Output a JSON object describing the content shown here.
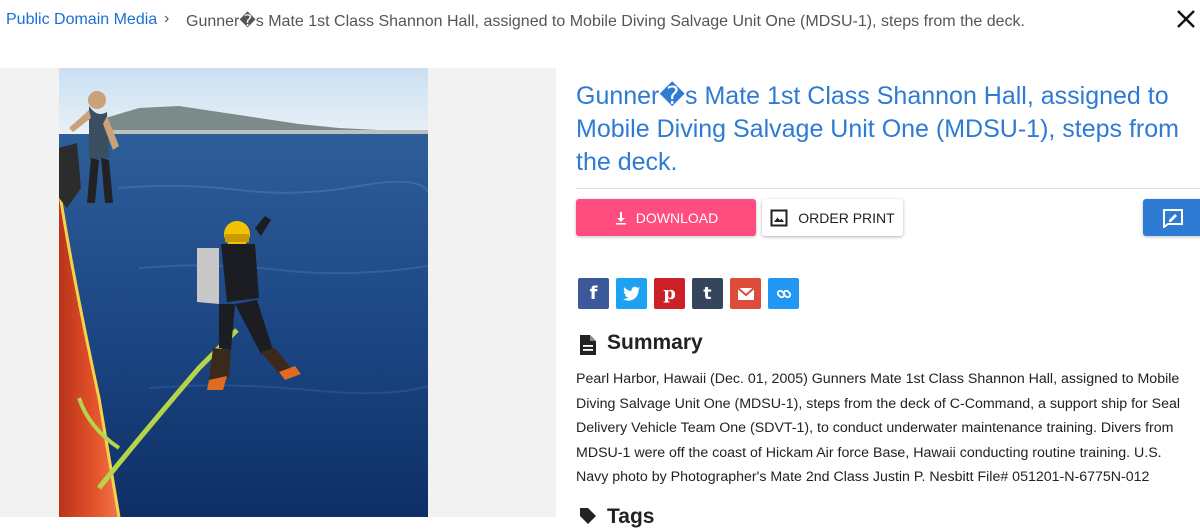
{
  "breadcrumb": {
    "root": "Public Domain Media",
    "separator": "›",
    "current": "Gunner�s Mate 1st Class Shannon Hall, assigned to Mobile Diving Salvage Unit One (MDSU-1), steps from the deck."
  },
  "title": "Gunner�s Mate 1st Class Shannon Hall, assigned to Mobile Diving Salvage Unit One (MDSU-1), steps from the deck.",
  "actions": {
    "download_label": "DOWNLOAD",
    "order_print_label": "ORDER PRINT"
  },
  "share_buttons": [
    {
      "name": "facebook",
      "glyph": "f",
      "color": "#3b5998"
    },
    {
      "name": "twitter",
      "glyph": "t",
      "color": "#1da1f2"
    },
    {
      "name": "pinterest",
      "glyph": "p",
      "color": "#cb2027"
    },
    {
      "name": "tumblr",
      "glyph": "t",
      "color": "#35465c"
    },
    {
      "name": "email",
      "glyph": "M",
      "color": "#dd4b39"
    },
    {
      "name": "link",
      "glyph": "link",
      "color": "#2196f3"
    }
  ],
  "summary": {
    "heading": "Summary",
    "text": "Pearl Harbor, Hawaii (Dec. 01, 2005) Gunners Mate 1st Class Shannon Hall, assigned to Mobile Diving Salvage Unit One (MDSU-1), steps from the deck of C-Command, a support ship for Seal Delivery Vehicle Team One (SDVT-1), to conduct underwater maintenance training. Divers from MDSU-1 were off the coast of Hickam Air force Base, Hawaii conducting routine training. U.S. Navy photo by Photographer's Mate 2nd Class Justin P. Nesbitt File# 051201-N-6775N-012"
  },
  "tags": {
    "heading": "Tags"
  },
  "colors": {
    "link": "#1a6fd6",
    "title": "#2e7bd4",
    "download": "#ff4d80",
    "edit": "#2e7bd4"
  }
}
